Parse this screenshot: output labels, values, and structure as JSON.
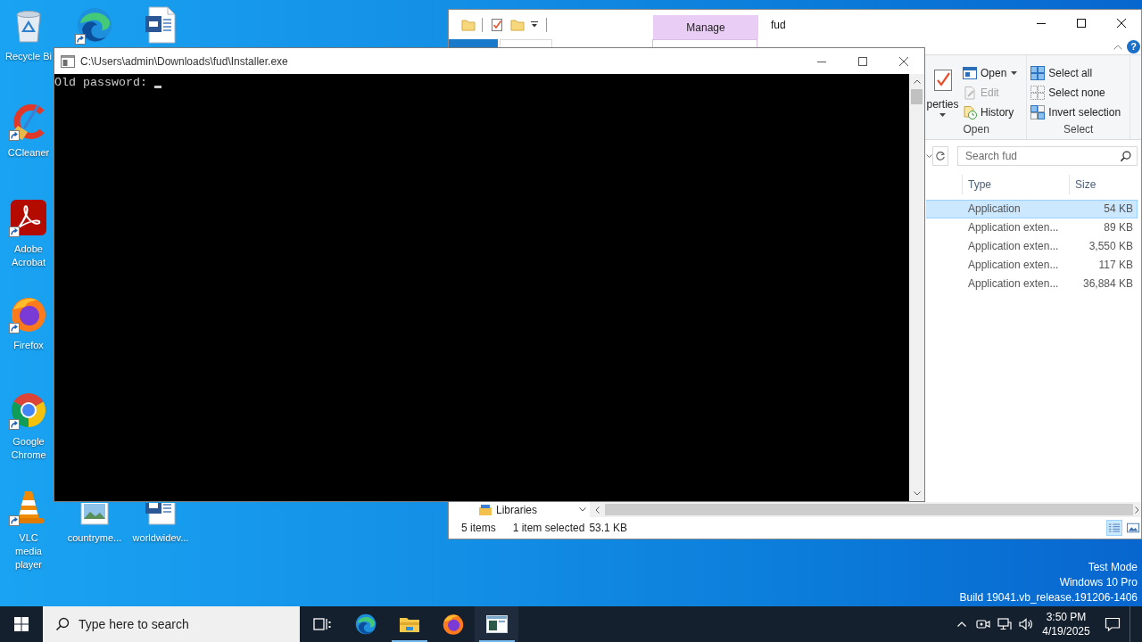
{
  "desktop": {
    "icon_rows": [
      [
        {
          "kind": "recycle-bin",
          "label": "Recycle Bi",
          "shortcut": false
        },
        {
          "kind": "edge",
          "shortcut": true
        },
        {
          "kind": "word-document",
          "shortcut": false
        }
      ],
      [
        {
          "kind": "ccleaner",
          "label": "CCleaner",
          "shortcut": true
        }
      ],
      [
        {
          "kind": "acrobat",
          "label": "Adobe Acrobat",
          "shortcut": true
        }
      ],
      [
        {
          "kind": "firefox",
          "label": "Firefox",
          "shortcut": true
        }
      ],
      [
        {
          "kind": "chrome",
          "label": "Google Chrome",
          "shortcut": true
        }
      ],
      [
        {
          "kind": "vlc",
          "label": "VLC media player",
          "shortcut": true
        },
        {
          "kind": "image-file",
          "label": "countryme...",
          "shortcut": false
        },
        {
          "kind": "word-document",
          "label": "worldwidev...",
          "shortcut": false
        }
      ]
    ],
    "notice": [
      "Test Mode",
      "Windows 10 Pro",
      "Build 19041.vb_release.191206-1406"
    ]
  },
  "explorer": {
    "title": "fud",
    "context_tab": "Manage",
    "help_button": "?",
    "ribbon": {
      "groups": [
        {
          "label": "Open",
          "items": [
            {
              "kind": "properties",
              "label": "perties",
              "dropdown": true,
              "disabled": false
            },
            {
              "kind": "open",
              "label": "Open",
              "dropdown": true,
              "disabled": false
            },
            {
              "kind": "edit",
              "label": "Edit",
              "dropdown": false,
              "disabled": true
            },
            {
              "kind": "history",
              "label": "History",
              "dropdown": false,
              "disabled": false
            }
          ]
        },
        {
          "label": "Select",
          "items": [
            {
              "kind": "select-all",
              "label": "Select all",
              "dropdown": false,
              "disabled": false
            },
            {
              "kind": "select-none",
              "label": "Select none",
              "dropdown": false,
              "disabled": false
            },
            {
              "kind": "invert-selection",
              "label": "Invert selection",
              "dropdown": false,
              "disabled": false
            }
          ]
        }
      ]
    },
    "search": {
      "placeholder": "Search fud"
    },
    "columns": [
      "Type",
      "Size"
    ],
    "rows": [
      {
        "type": "Application",
        "size": "54 KB",
        "selected": true
      },
      {
        "type": "Application exten...",
        "size": "89 KB",
        "selected": false
      },
      {
        "type": "Application exten...",
        "size": "3,550 KB",
        "selected": false
      },
      {
        "type": "Application exten...",
        "size": "117 KB",
        "selected": false
      },
      {
        "type": "Application exten...",
        "size": "36,884 KB",
        "selected": false
      }
    ],
    "nav_pane": {
      "items": [
        {
          "label": "Libraries"
        }
      ]
    },
    "status_bar": {
      "item_count": "5 items",
      "selection": "1 item selected",
      "selection_size": "53.1 KB"
    },
    "views": [
      {
        "kind": "details",
        "selected": true
      },
      {
        "kind": "large-icons",
        "selected": false
      }
    ]
  },
  "console": {
    "title": "C:\\Users\\admin\\Downloads\\fud\\Installer.exe",
    "lines": [
      "Old password:"
    ],
    "cursor": true
  },
  "taskbar": {
    "search": {
      "placeholder": "Type here to search"
    },
    "apps": [
      {
        "kind": "task-view",
        "open": false,
        "active": false
      },
      {
        "kind": "edge",
        "open": false,
        "active": false
      },
      {
        "kind": "file-explorer",
        "open": true,
        "active": false
      },
      {
        "kind": "firefox",
        "open": false,
        "active": false
      },
      {
        "kind": "console",
        "open": true,
        "active": true
      }
    ],
    "clock": {
      "time": "3:50 PM",
      "date": "4/19/2025"
    }
  }
}
